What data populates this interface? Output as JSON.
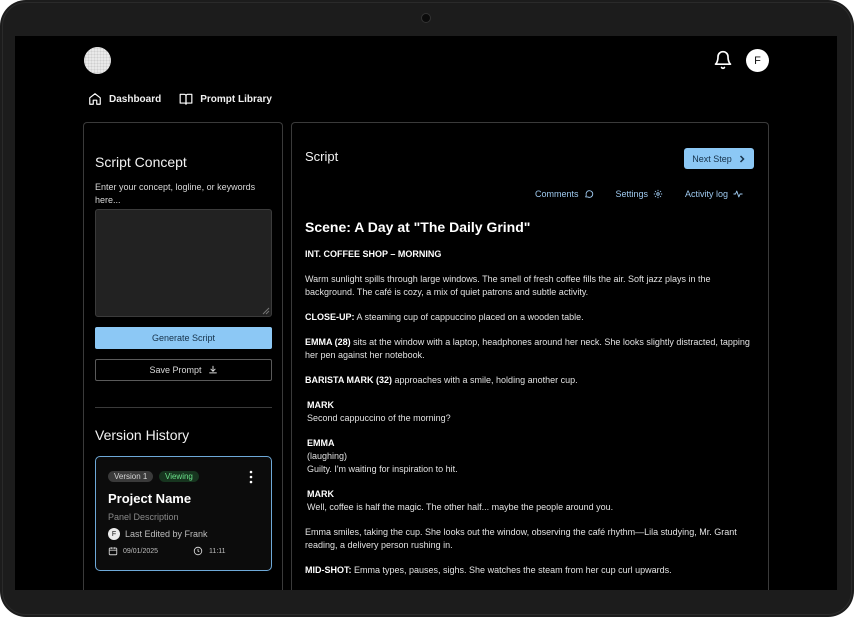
{
  "topbar": {
    "avatar_initial": "F"
  },
  "nav": [
    {
      "label": "Dashboard",
      "icon": "home-icon"
    },
    {
      "label": "Prompt Library",
      "icon": "book-icon"
    }
  ],
  "concept_panel": {
    "title": "Script Concept",
    "description": "Enter your concept, logline, or keywords here...",
    "input_value": "",
    "generate_label": "Generate Script",
    "save_label": "Save Prompt"
  },
  "version_history": {
    "title": "Version History",
    "card": {
      "version_label": "Version 1",
      "status_label": "Viewing",
      "project_name": "Project Name",
      "description": "Panel Description",
      "editor_initial": "F",
      "edited_by": "Last Edited by Frank",
      "date": "09/01/2025",
      "time": "11:11"
    }
  },
  "script_panel": {
    "title": "Script",
    "next_label": "Next Step",
    "toolbar": {
      "comments": "Comments",
      "settings": "Settings",
      "activity": "Activity log"
    },
    "scene_title": "Scene: A Day at \"The Daily Grind\"",
    "heading": "INT. COFFEE SHOP – MORNING",
    "p1": "Warm sunlight spills through large windows. The smell of fresh coffee fills the air. Soft jazz plays in the background. The café is cozy, a mix of quiet patrons and subtle activity.",
    "p2_lead": "CLOSE-UP:",
    "p2": " A steaming cup of cappuccino placed on a wooden table.",
    "p3_lead": "EMMA (28)",
    "p3": " sits at the window with a laptop, headphones around her neck. She looks slightly distracted, tapping her pen against her notebook.",
    "p4_lead": "BARISTA MARK (32)",
    "p4": " approaches with a smile, holding another cup.",
    "d1_name": "MARK",
    "d1_line": "Second cappuccino of the morning?",
    "d2_name": "EMMA",
    "d2_paren": "(laughing)",
    "d2_line": "Guilty. I'm waiting for inspiration to hit.",
    "d3_name": "MARK",
    "d3_line": "Well, coffee is half the magic. The other half... maybe the people around you.",
    "p5": "Emma smiles, taking the cup. She looks out the window, observing the café rhythm—Lila studying, Mr. Grant reading, a delivery person rushing in.",
    "p6_lead": "MID-SHOT:",
    "p6": " Emma types, pauses, sighs. She watches the steam from her cup curl upwards."
  }
}
